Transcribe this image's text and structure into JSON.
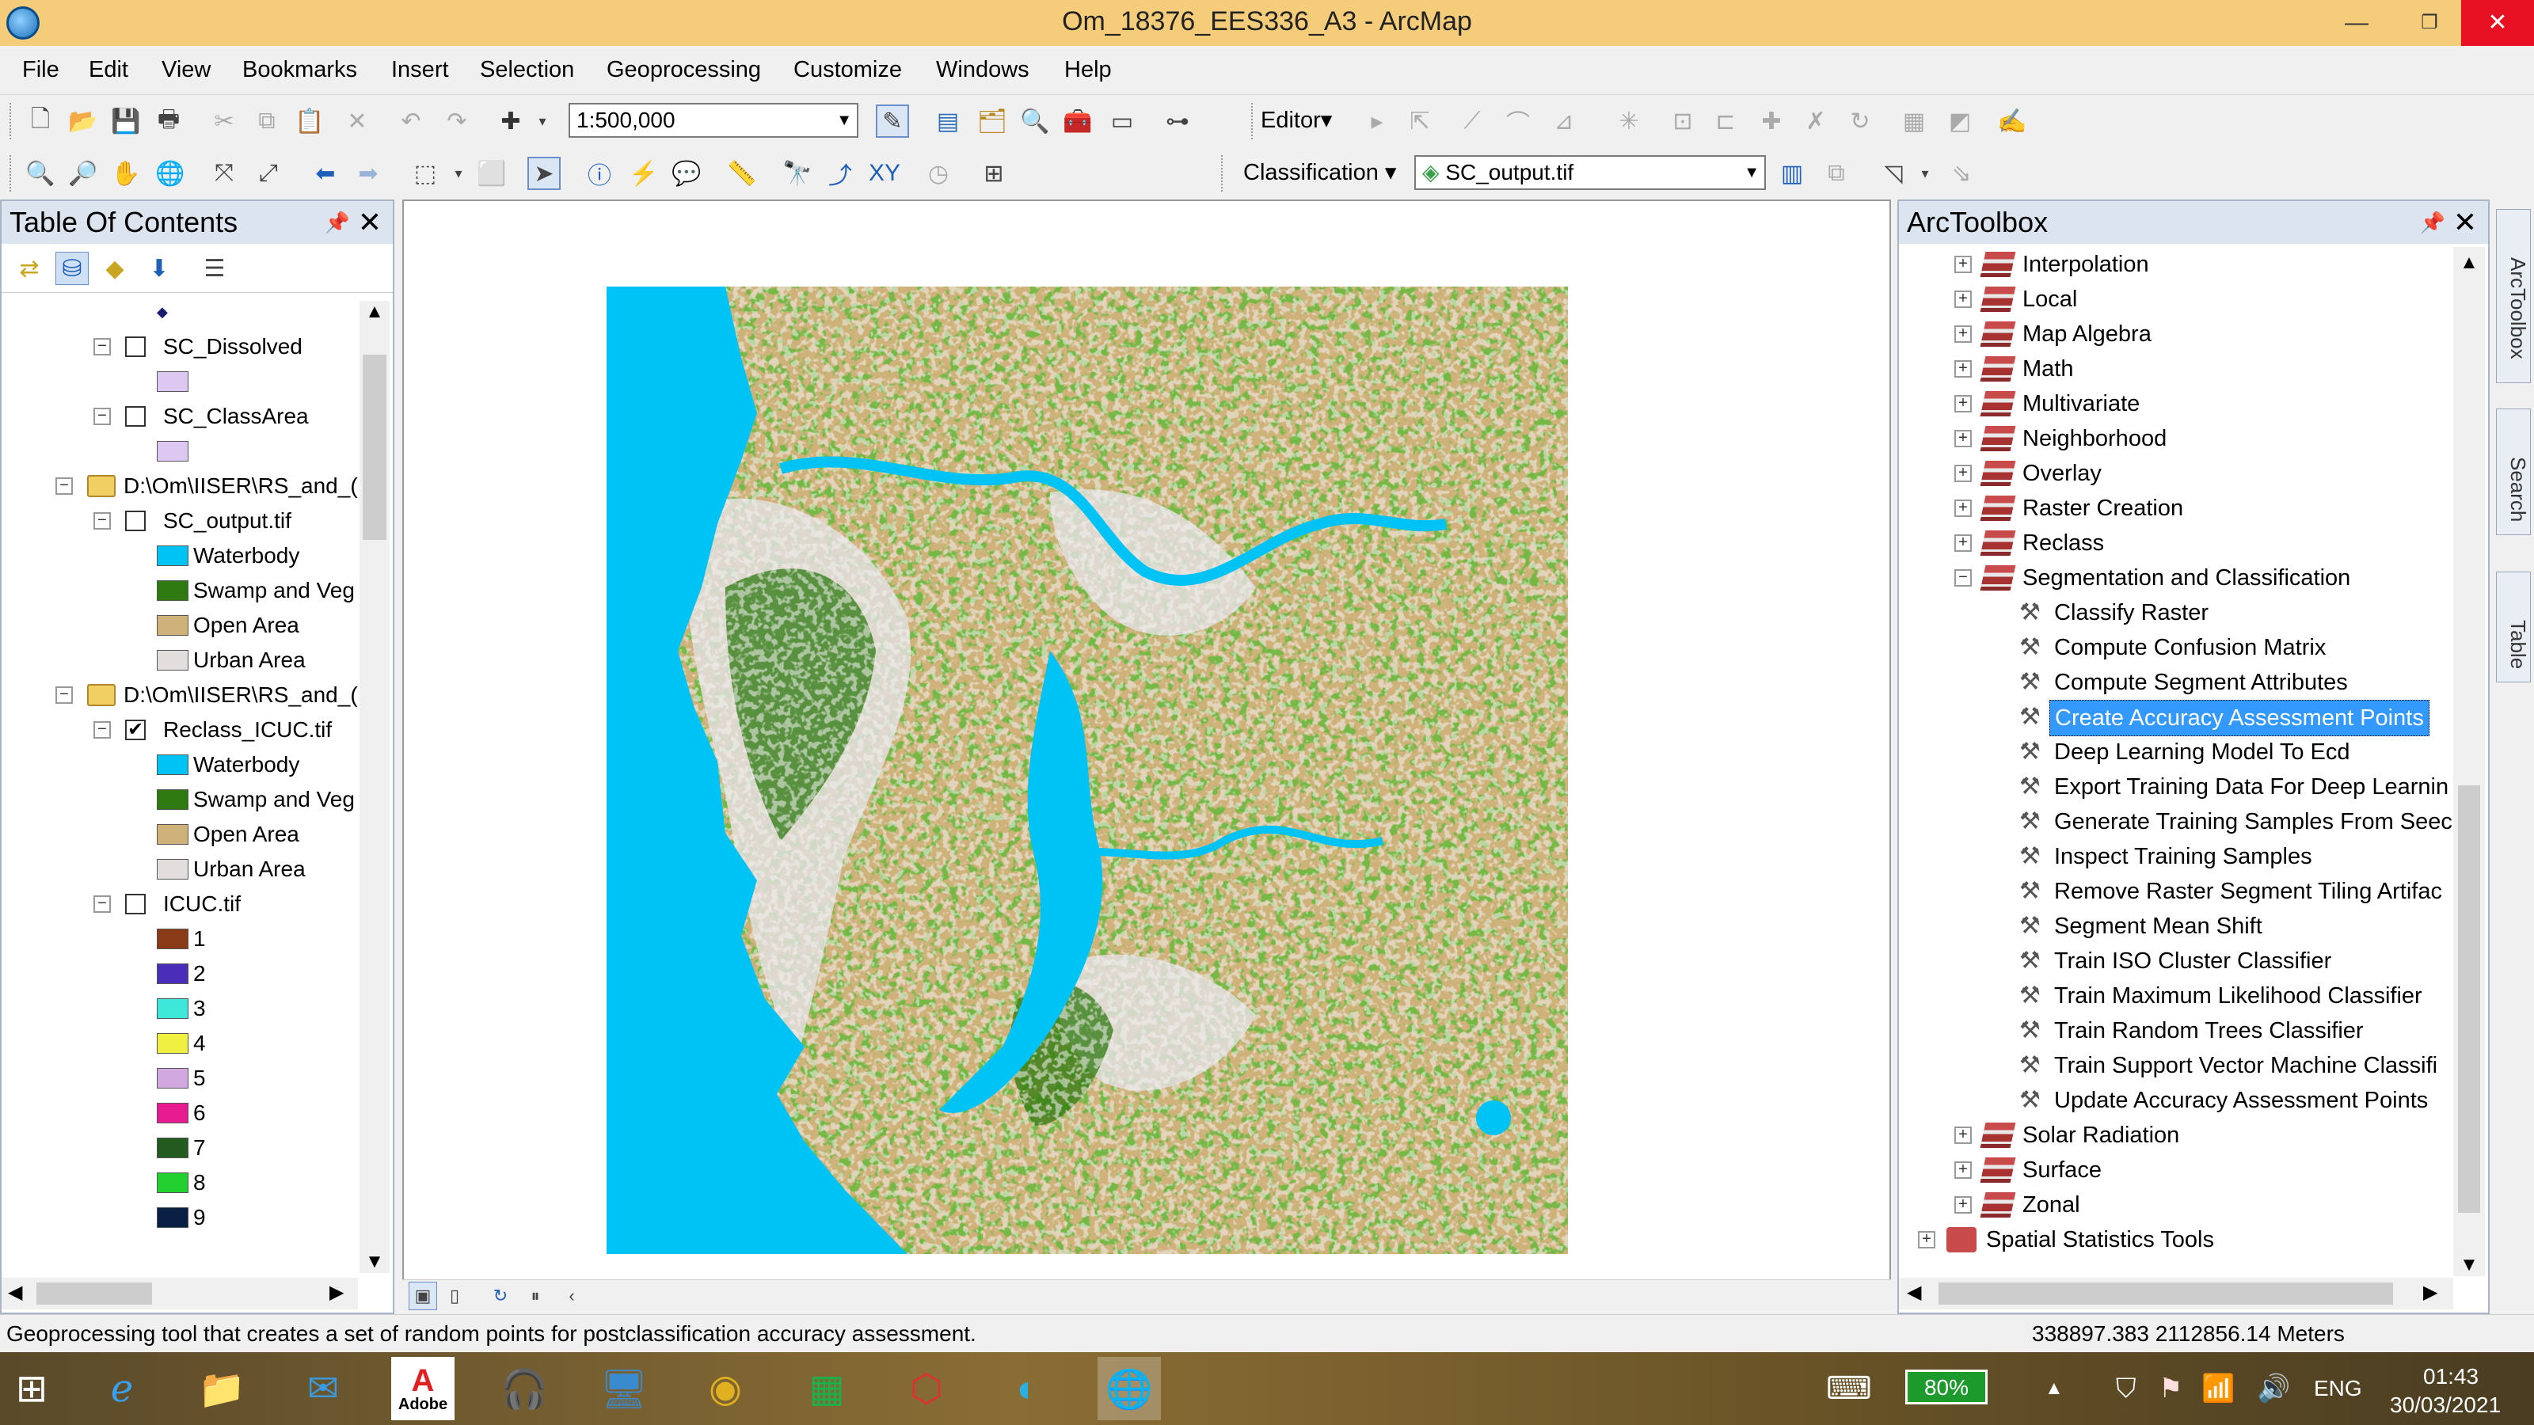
{
  "window": {
    "title": "Om_18376_EES336_A3 - ArcMap",
    "minimize": "—",
    "restore": "❐",
    "close": "✕"
  },
  "menu": [
    "File",
    "Edit",
    "View",
    "Bookmarks",
    "Insert",
    "Selection",
    "Geoprocessing",
    "Customize",
    "Windows",
    "Help"
  ],
  "toolbar": {
    "scale": "1:500,000",
    "editor_label": "Editor▾",
    "classification_label": "Classification ▾",
    "layer_combo": "SC_output.tif"
  },
  "toc": {
    "title": "Table Of Contents",
    "pin": "📌",
    "close": "✕",
    "layers": [
      {
        "name": "SC_Dissolved",
        "checked": false,
        "symbols": [
          {
            "label": "",
            "color": "#dcc8f0"
          }
        ]
      },
      {
        "name": "SC_ClassArea",
        "checked": false,
        "symbols": [
          {
            "label": "",
            "color": "#dcc8f0"
          }
        ]
      },
      {
        "group": "D:\\Om\\IISER\\RS_and_("
      },
      {
        "name": "SC_output.tif",
        "checked": false,
        "symbols": [
          {
            "label": "Waterbody",
            "color": "#00c3f5"
          },
          {
            "label": "Swamp and Veg",
            "color": "#2e7a10"
          },
          {
            "label": "Open Area",
            "color": "#cfb27a"
          },
          {
            "label": "Urban Area",
            "color": "#e2dede"
          }
        ]
      },
      {
        "group": "D:\\Om\\IISER\\RS_and_("
      },
      {
        "name": "Reclass_ICUC.tif",
        "checked": true,
        "symbols": [
          {
            "label": "Waterbody",
            "color": "#00c3f5"
          },
          {
            "label": "Swamp and Veg",
            "color": "#2e7a10"
          },
          {
            "label": "Open Area",
            "color": "#cfb27a"
          },
          {
            "label": "Urban Area",
            "color": "#e2dede"
          }
        ]
      },
      {
        "name": "ICUC.tif",
        "checked": false,
        "symbols": [
          {
            "label": "1",
            "color": "#8b3a17"
          },
          {
            "label": "2",
            "color": "#4a2db8"
          },
          {
            "label": "3",
            "color": "#3ee8d8"
          },
          {
            "label": "4",
            "color": "#f0f040"
          },
          {
            "label": "5",
            "color": "#d2a8e0"
          },
          {
            "label": "6",
            "color": "#e81c90"
          },
          {
            "label": "7",
            "color": "#235a20"
          },
          {
            "label": "8",
            "color": "#22d030"
          },
          {
            "label": "9",
            "color": "#0a1f44"
          }
        ]
      }
    ]
  },
  "arctoolbox": {
    "title": "ArcToolbox",
    "toolsets": [
      "Interpolation",
      "Local",
      "Map Algebra",
      "Math",
      "Multivariate",
      "Neighborhood",
      "Overlay",
      "Raster Creation",
      "Reclass"
    ],
    "expanded": "Segmentation and Classification",
    "tools": [
      "Classify Raster",
      "Compute Confusion Matrix",
      "Compute Segment Attributes",
      "Create Accuracy Assessment Points",
      "Deep Learning Model To Ecd",
      "Export Training Data For Deep Learnin",
      "Generate Training Samples From Seec",
      "Inspect Training Samples",
      "Remove Raster Segment Tiling Artifac",
      "Segment Mean Shift",
      "Train ISO Cluster Classifier",
      "Train Maximum Likelihood Classifier",
      "Train Random Trees Classifier",
      "Train Support Vector Machine Classifi",
      "Update Accuracy Assessment Points"
    ],
    "selected_tool": "Create Accuracy Assessment Points",
    "after": [
      "Solar Radiation",
      "Surface",
      "Zonal"
    ],
    "next_toolbox": "Spatial Statistics Tools"
  },
  "sidetabs": [
    "ArcToolbox",
    "Search",
    "Table"
  ],
  "status": {
    "message": "Geoprocessing tool that creates a set of random points for postclassification accuracy assessment.",
    "coords": "338897.383  2112856.14 Meters"
  },
  "taskbar": {
    "battery": "80%",
    "lang": "ENG",
    "time": "01:43",
    "date": "30/03/2021",
    "adobe_label": "Adobe"
  },
  "map_colors": {
    "water": "#00c3f5",
    "veg": "#2e7a10",
    "open": "#cfb27a",
    "urban": "#e2dede"
  }
}
